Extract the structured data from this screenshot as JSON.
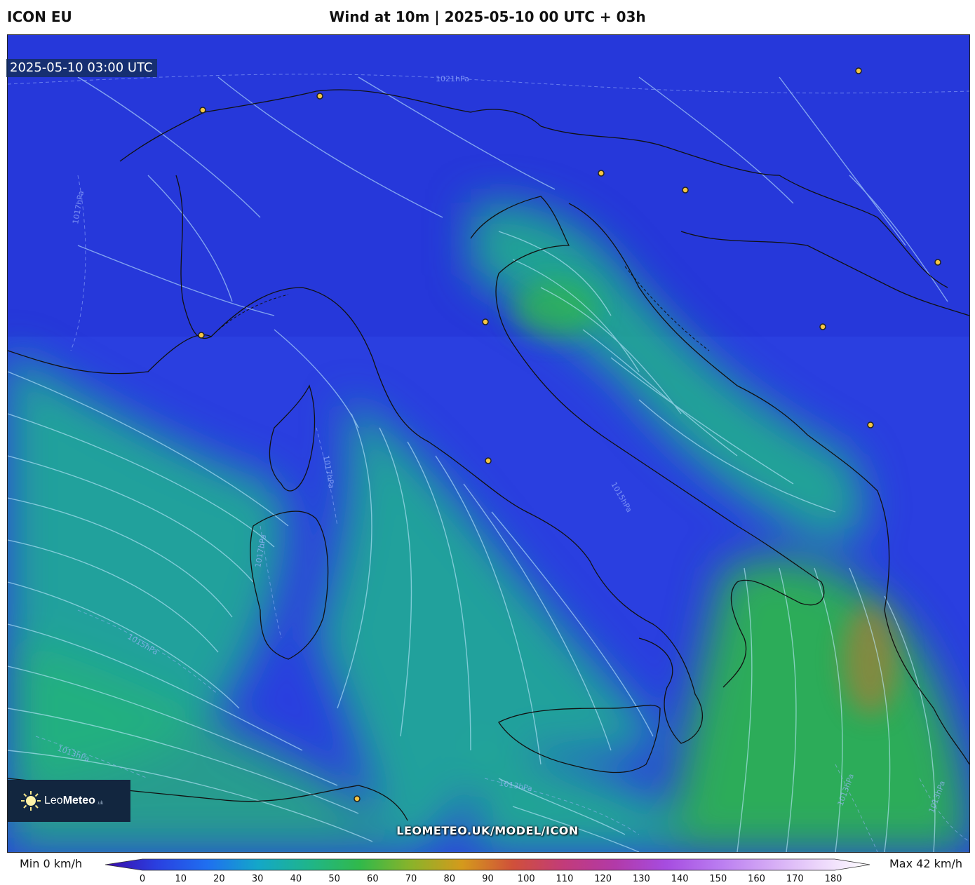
{
  "header": {
    "model": "ICON EU",
    "title": "Wind at 10m | 2025-05-10 00 UTC + 03h"
  },
  "map": {
    "timestamp": "2025-05-10 03:00 UTC",
    "watermark": "LEOMETEO.UK/MODEL/ICON",
    "isobar_labels": [
      "1021hPa",
      "1017hPa",
      "1017hPa",
      "1017hPa",
      "1015hPa",
      "1013hPa",
      "1013hPa",
      "1013hPa",
      "1013hPa",
      "1015hPa"
    ],
    "colors": {
      "calm": "#2a3fe0",
      "moderate": "#1fb58a",
      "strong": "#31b94a",
      "peak": "#c8702e",
      "borders": "#111111",
      "streamlines": "#bfe9ff",
      "city_marker": "#f5c542"
    }
  },
  "logo": {
    "name_light": "Leo",
    "name_bold": "Meteo",
    "suffix": ".uk"
  },
  "legend": {
    "min_label": "Min 0 km/h",
    "max_label": "Max 42 km/h",
    "ticks": [
      0,
      10,
      20,
      30,
      40,
      50,
      60,
      70,
      80,
      90,
      100,
      110,
      120,
      130,
      140,
      150,
      160,
      170,
      180
    ],
    "scale_colors": [
      "#3b0aa8",
      "#2a3fe0",
      "#1f6ff0",
      "#14a7c8",
      "#1fb58a",
      "#31b94a",
      "#8ab32a",
      "#d49a1c",
      "#d0503a",
      "#c23b7a",
      "#b23aa8",
      "#a64ce0",
      "#b97af0",
      "#d3a8f5",
      "#ecd6fb",
      "#ffffff"
    ]
  }
}
